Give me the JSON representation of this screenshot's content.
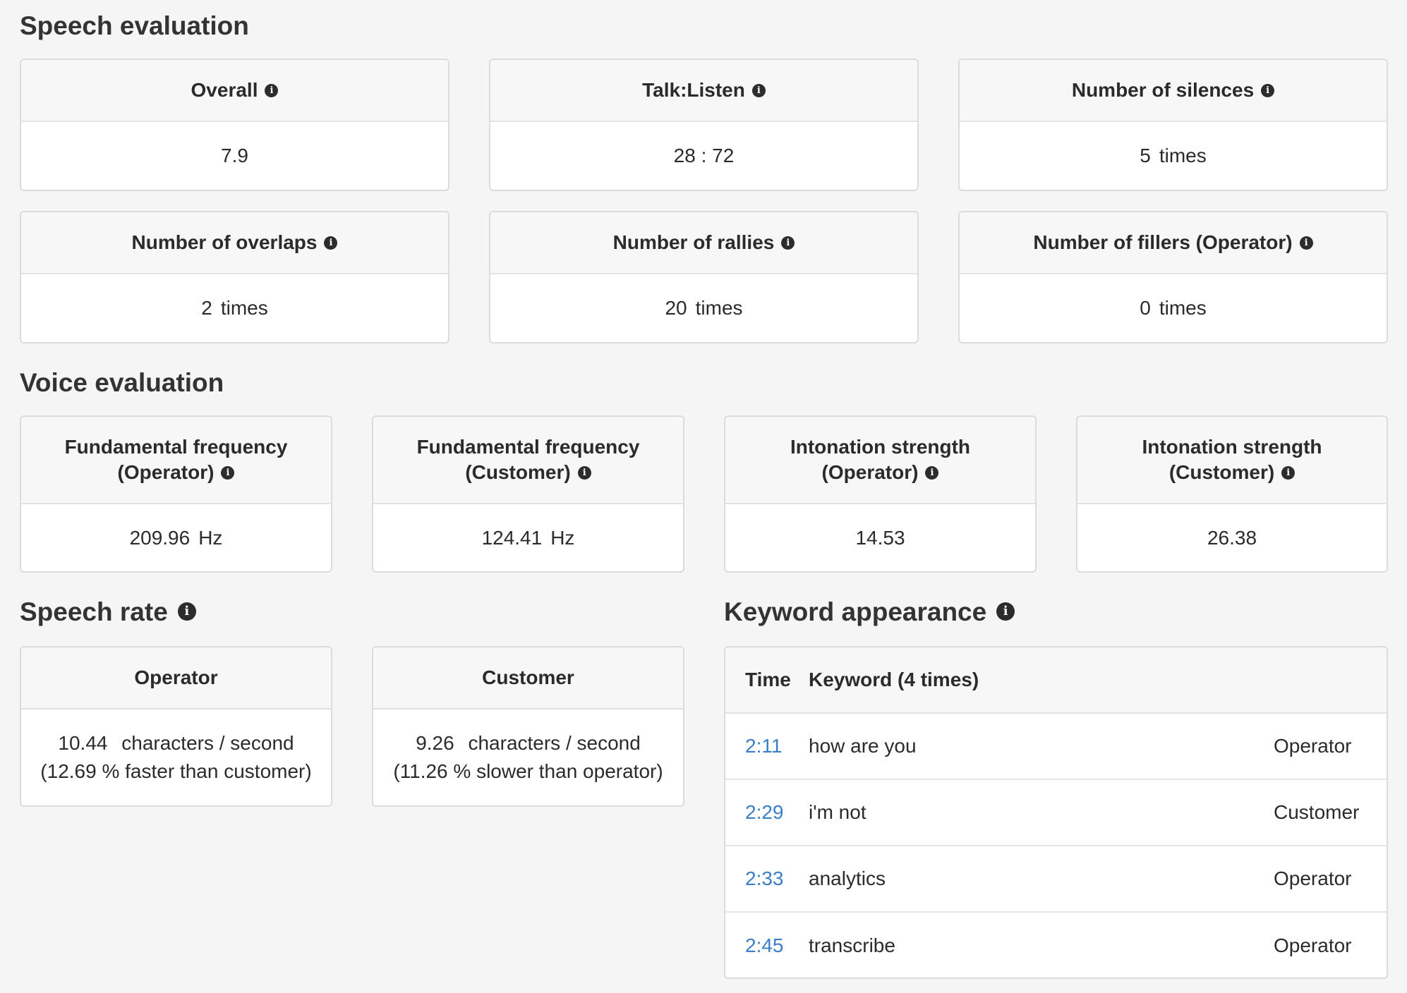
{
  "speech_evaluation": {
    "title": "Speech evaluation",
    "cards": [
      {
        "label": "Overall",
        "value": "7.9",
        "unit": ""
      },
      {
        "label": "Talk:Listen",
        "value": "28 : 72",
        "unit": ""
      },
      {
        "label": "Number of silences",
        "value": "5",
        "unit": "times"
      },
      {
        "label": "Number of overlaps",
        "value": "2",
        "unit": "times"
      },
      {
        "label": "Number of rallies",
        "value": "20",
        "unit": "times"
      },
      {
        "label": "Number of fillers (Operator)",
        "value": "0",
        "unit": "times"
      }
    ]
  },
  "voice_evaluation": {
    "title": "Voice evaluation",
    "cards": [
      {
        "label_line1": "Fundamental frequency",
        "label_line2": "(Operator)",
        "value": "209.96",
        "unit": "Hz"
      },
      {
        "label_line1": "Fundamental frequency",
        "label_line2": "(Customer)",
        "value": "124.41",
        "unit": "Hz"
      },
      {
        "label_line1": "Intonation strength",
        "label_line2": "(Operator)",
        "value": "14.53",
        "unit": ""
      },
      {
        "label_line1": "Intonation strength",
        "label_line2": "(Customer)",
        "value": "26.38",
        "unit": ""
      }
    ]
  },
  "speech_rate": {
    "title": "Speech rate",
    "cards": [
      {
        "label": "Operator",
        "value": "10.44",
        "unit": "characters / second",
        "comparison": "(12.69 % faster than customer)"
      },
      {
        "label": "Customer",
        "value": "9.26",
        "unit": "characters / second",
        "comparison": "(11.26 % slower than operator)"
      }
    ]
  },
  "keyword_appearance": {
    "title": "Keyword appearance",
    "columns": {
      "time": "Time",
      "keyword": "Keyword (4 times)"
    },
    "rows": [
      {
        "time": "2:11",
        "keyword": "how are you",
        "speaker": "Operator"
      },
      {
        "time": "2:29",
        "keyword": "i'm not",
        "speaker": "Customer"
      },
      {
        "time": "2:33",
        "keyword": "analytics",
        "speaker": "Operator"
      },
      {
        "time": "2:45",
        "keyword": "transcribe",
        "speaker": "Operator"
      }
    ]
  },
  "icons": {
    "info": "info-icon",
    "info_glyph": "i"
  },
  "colors": {
    "link": "#3a7fc8",
    "background": "#f5f5f5",
    "card_border": "#dcdcdc"
  }
}
